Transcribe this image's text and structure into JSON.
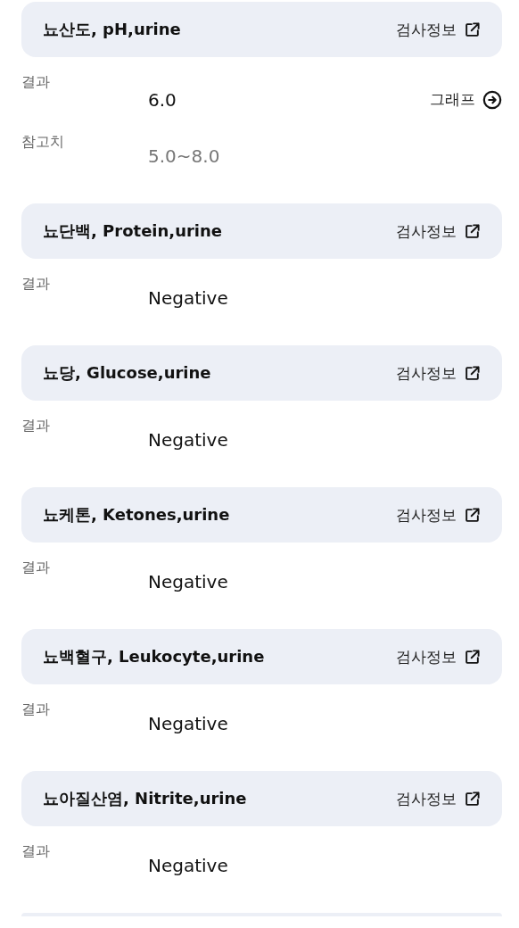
{
  "tests": [
    {
      "title": "뇨산도, pH,urine",
      "info_label": "검사정보",
      "rows": [
        {
          "kind": "result",
          "label": "결과",
          "value": "6.0",
          "link": "그래프"
        },
        {
          "kind": "reference",
          "label": "참고치",
          "value": "5.0~8.0"
        }
      ]
    },
    {
      "title": "뇨단백, Protein,urine",
      "info_label": "검사정보",
      "rows": [
        {
          "kind": "result",
          "label": "결과",
          "value": "Negative"
        }
      ]
    },
    {
      "title": "뇨당, Glucose,urine",
      "info_label": "검사정보",
      "rows": [
        {
          "kind": "result",
          "label": "결과",
          "value": "Negative"
        }
      ]
    },
    {
      "title": "뇨케톤, Ketones,urine",
      "info_label": "검사정보",
      "rows": [
        {
          "kind": "result",
          "label": "결과",
          "value": "Negative"
        }
      ]
    },
    {
      "title": "뇨백혈구, Leukocyte,urine",
      "info_label": "검사정보",
      "rows": [
        {
          "kind": "result",
          "label": "결과",
          "value": "Negative"
        }
      ]
    },
    {
      "title": "뇨아질산염, Nitrite,urine",
      "info_label": "검사정보",
      "rows": [
        {
          "kind": "result",
          "label": "결과",
          "value": "Negative"
        }
      ]
    }
  ]
}
